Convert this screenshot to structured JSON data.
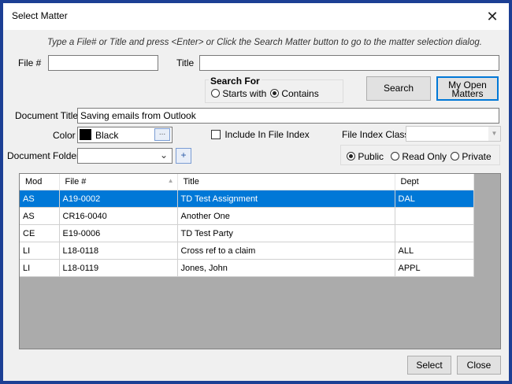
{
  "window": {
    "title": "Select Matter"
  },
  "instruction": "Type a File# or Title and press <Enter> or Click the Search Matter button to go to the matter selection dialog.",
  "search": {
    "file_label": "File #",
    "file_value": "",
    "title_label": "Title",
    "title_value": "",
    "search_for_label": "Search For",
    "starts_with_label": "Starts with",
    "contains_label": "Contains",
    "selected_mode": "Contains",
    "search_button": "Search",
    "my_open_matters_button": "My Open Matters"
  },
  "document": {
    "title_label": "Document Title",
    "title_value": "Saving emails from Outlook",
    "color_label": "Color",
    "color_name": "Black",
    "color_swatch": "#000000",
    "color_picker_button": "...",
    "include_index_label": "Include In File Index",
    "include_index_checked": false,
    "file_index_class_label": "File Index Class",
    "file_index_class_value": "",
    "folder_label": "Document Folder",
    "folder_value": "",
    "add_folder_button": "+",
    "access_public": "Public",
    "access_read_only": "Read Only",
    "access_private": "Private",
    "access_selected": "Public"
  },
  "grid": {
    "columns": [
      "Mod",
      "File #",
      "Title",
      "Dept"
    ],
    "rows": [
      {
        "mod": "AS",
        "file": "A19-0002",
        "title": "TD Test Assignment",
        "dept": "DAL",
        "selected": true
      },
      {
        "mod": "AS",
        "file": "CR16-0040",
        "title": "Another One",
        "dept": "",
        "selected": false
      },
      {
        "mod": "CE",
        "file": "E19-0006",
        "title": "TD Test Party",
        "dept": "",
        "selected": false
      },
      {
        "mod": "LI",
        "file": "L18-0118",
        "title": "Cross ref to a claim",
        "dept": "ALL",
        "selected": false
      },
      {
        "mod": "LI",
        "file": "L18-0119",
        "title": "Jones, John",
        "dept": "APPL",
        "selected": false
      }
    ]
  },
  "footer": {
    "select_button": "Select",
    "close_button": "Close"
  },
  "colors": {
    "selection": "#0078d7",
    "frame": "#1c3f94",
    "focus_border": "#0078d7"
  }
}
